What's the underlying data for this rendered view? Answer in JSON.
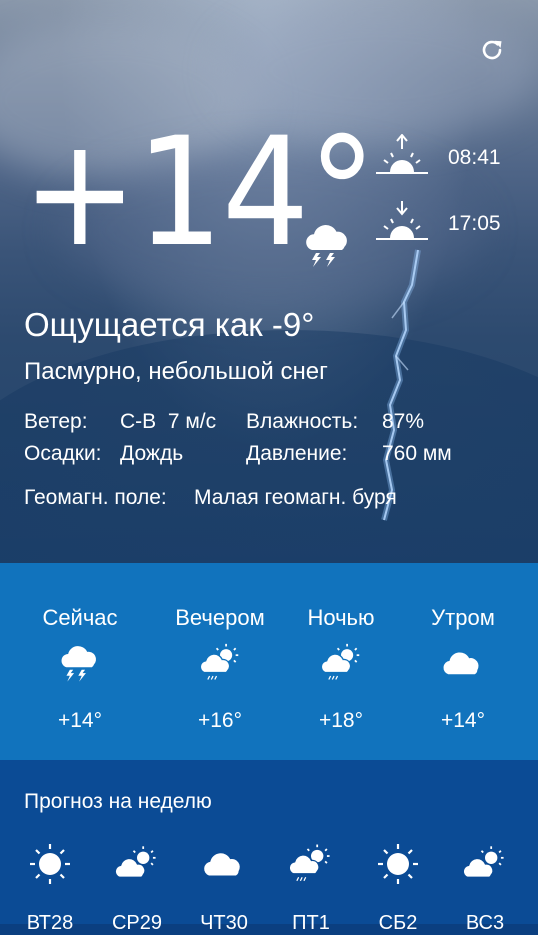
{
  "current": {
    "temperature": "+14°",
    "feels_like": "Ощущается как -9°",
    "condition": "Пасмурно, небольшой снег",
    "icon": "thunderstorm-icon"
  },
  "sun": {
    "sunrise": "08:41",
    "sunset": "17:05"
  },
  "details": {
    "wind_label": "Ветер:",
    "wind_value": "С-В  7 м/с",
    "humidity_label": "Влажность:",
    "humidity_value": "87%",
    "precip_label": "Осадки:",
    "precip_value": "Дождь",
    "pressure_label": "Давление:",
    "pressure_value": "760 мм",
    "geomag_label": "Геомагн. поле:",
    "geomag_value": "Малая геомагн. буря"
  },
  "periods": [
    {
      "label": "Сейчас",
      "icon": "thunderstorm-icon",
      "temp": "+14°"
    },
    {
      "label": "Вечером",
      "icon": "partly-cloudy-rain-icon",
      "temp": "+16°"
    },
    {
      "label": "Ночью",
      "icon": "partly-cloudy-rain-icon",
      "temp": "+18°"
    },
    {
      "label": "Утром",
      "icon": "cloud-icon",
      "temp": "+14°"
    }
  ],
  "week": {
    "title": "Прогноз на неделю",
    "days": [
      {
        "day": "ВТ28",
        "icon": "sun-icon"
      },
      {
        "day": "СР29",
        "icon": "partly-cloudy-icon"
      },
      {
        "day": "ЧТ30",
        "icon": "cloud-icon"
      },
      {
        "day": "ПТ1",
        "icon": "partly-cloudy-rain-icon"
      },
      {
        "day": "СБ2",
        "icon": "sun-icon"
      },
      {
        "day": "ВС3",
        "icon": "partly-cloudy-icon"
      }
    ]
  },
  "colors": {
    "periods_bg": "#1173bd",
    "week_bg": "#0b4b95"
  }
}
